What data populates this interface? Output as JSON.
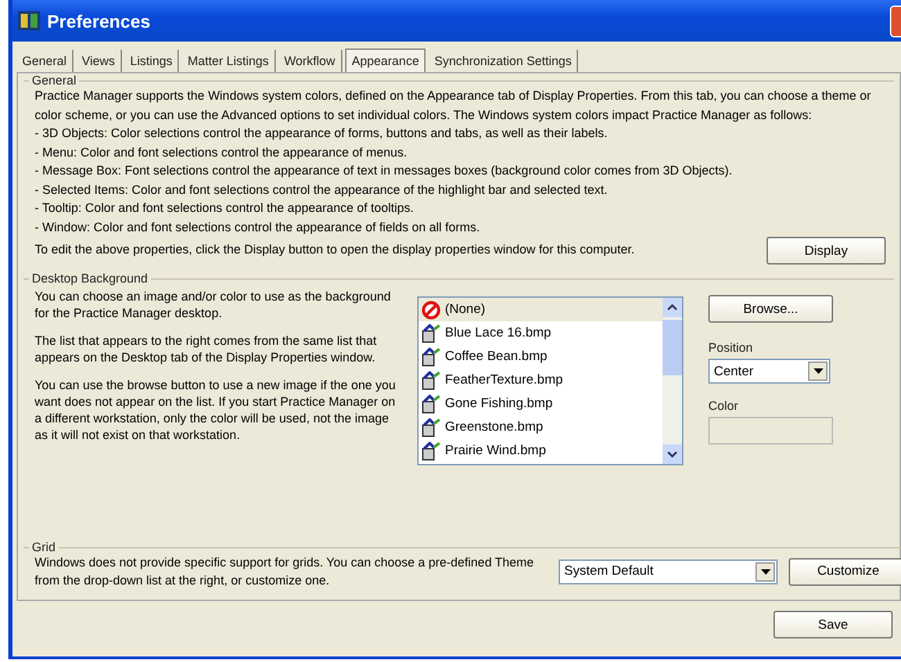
{
  "window": {
    "title": "Preferences"
  },
  "tabs": [
    {
      "label": "General",
      "selected": false
    },
    {
      "label": "Views",
      "selected": false
    },
    {
      "label": "Listings",
      "selected": false
    },
    {
      "label": "Matter Listings",
      "selected": false
    },
    {
      "label": "Workflow",
      "selected": false
    },
    {
      "label": "Appearance",
      "selected": true
    },
    {
      "label": "Synchronization Settings",
      "selected": false
    }
  ],
  "general": {
    "title": "General",
    "lines": [
      "Practice Manager supports the Windows system colors, defined on the Appearance tab of Display Properties. From this tab, you can choose a theme or color scheme, or you can use the Advanced options to set individual colors. The Windows system colors impact Practice Manager as follows:",
      "- 3D Objects: Color selections control the appearance of forms, buttons and tabs, as well as their labels.",
      "- Menu: Color and font selections control the appearance of menus.",
      "- Message Box: Font selections control the appearance of text in messages boxes (background color comes from 3D Objects).",
      "- Selected Items: Color and font selections control the appearance of the highlight bar and selected text.",
      "- Tooltip: Color and font selections control the appearance of tooltips.",
      "- Window: Color and font selections control the appearance of fields on all forms."
    ],
    "last_line": "To edit the above properties, click the Display button to open the display properties window for this computer.",
    "button": "Display"
  },
  "desktop_background": {
    "title": "Desktop Background",
    "paragraphs": [
      "You can choose an image and/or color to use as the background for the Practice Manager desktop.",
      "The list that appears to the right comes from the same list that appears on the Desktop tab of the Display Properties window.",
      "You can use the browse button to use a new image if the one you want does not appear on the list.  If you start Practice Manager on a different workstation, only the color will be used, not the image as it will not exist on that workstation."
    ],
    "images": [
      {
        "label": "(None)",
        "kind": "none",
        "selected": true
      },
      {
        "label": "Blue Lace 16.bmp",
        "kind": "image",
        "selected": false
      },
      {
        "label": "Coffee Bean.bmp",
        "kind": "image",
        "selected": false
      },
      {
        "label": "FeatherTexture.bmp",
        "kind": "image",
        "selected": false
      },
      {
        "label": "Gone Fishing.bmp",
        "kind": "image",
        "selected": false
      },
      {
        "label": "Greenstone.bmp",
        "kind": "image",
        "selected": false
      },
      {
        "label": "Prairie Wind.bmp",
        "kind": "image",
        "selected": false
      }
    ],
    "browse_button": "Browse...",
    "position_label": "Position",
    "position_value": "Center",
    "color_label": "Color"
  },
  "grid": {
    "title": "Grid",
    "text": "Windows does not provide specific support for grids. You can choose a pre-defined Theme from the drop-down list at the right, or customize one.",
    "theme_value": "System Default",
    "button": "Customize"
  },
  "save_button": "Save"
}
